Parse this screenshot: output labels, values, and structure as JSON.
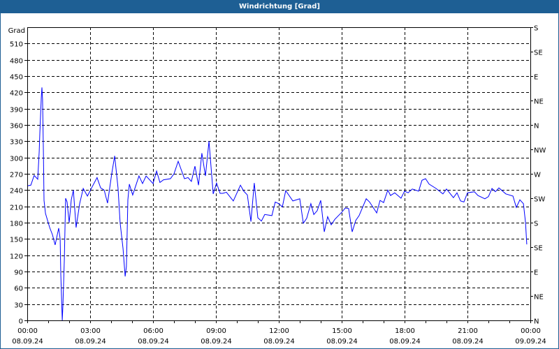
{
  "window": {
    "title": "Windrichtung [Grad]"
  },
  "chart_data": {
    "type": "line",
    "title": "Windrichtung [Grad]",
    "ylabel": "Grad",
    "xlabel": "",
    "ylim": [
      0,
      540
    ],
    "xlim_hours": [
      0,
      24
    ],
    "grid": true,
    "y_ticks": [
      0,
      30,
      60,
      90,
      120,
      150,
      180,
      210,
      240,
      270,
      300,
      330,
      360,
      390,
      420,
      450,
      480,
      510
    ],
    "y_tick_labels": [
      "0",
      "30",
      "60",
      "90",
      "120",
      "150",
      "180",
      "210",
      "240",
      "270",
      "300",
      "330",
      "360",
      "390",
      "420",
      "450",
      "480",
      "510"
    ],
    "right_axis_ticks": [
      0,
      45,
      90,
      135,
      180,
      225,
      270,
      315,
      360,
      405,
      450,
      495,
      540
    ],
    "right_axis_labels": [
      "N",
      "NE",
      "E",
      "SE",
      "S",
      "SW",
      "W",
      "NW",
      "N",
      "NE",
      "E",
      "SE",
      "S"
    ],
    "x_ticks_hours": [
      0,
      3,
      6,
      9,
      12,
      15,
      18,
      21,
      24
    ],
    "x_tick_times": [
      "00:00",
      "03:00",
      "06:00",
      "09:00",
      "12:00",
      "15:00",
      "18:00",
      "21:00",
      "00:00"
    ],
    "x_tick_dates": [
      "08.09.24",
      "08.09.24",
      "08.09.24",
      "08.09.24",
      "08.09.24",
      "08.09.24",
      "08.09.24",
      "08.09.24",
      "09.09.24"
    ],
    "line_color": "#0000ff",
    "series": [
      {
        "name": "Windrichtung",
        "points": [
          [
            0.03,
            248
          ],
          [
            0.17,
            249
          ],
          [
            0.33,
            267
          ],
          [
            0.5,
            260
          ],
          [
            0.57,
            311
          ],
          [
            0.6,
            344
          ],
          [
            0.67,
            411
          ],
          [
            0.7,
            429
          ],
          [
            0.73,
            407
          ],
          [
            0.77,
            312
          ],
          [
            0.8,
            221
          ],
          [
            0.87,
            197
          ],
          [
            1.07,
            171
          ],
          [
            1.2,
            158
          ],
          [
            1.33,
            139
          ],
          [
            1.5,
            170
          ],
          [
            1.57,
            150
          ],
          [
            1.6,
            86
          ],
          [
            1.67,
            0
          ],
          [
            1.7,
            26
          ],
          [
            1.77,
            113
          ],
          [
            1.83,
            225
          ],
          [
            1.9,
            218
          ],
          [
            2.0,
            180
          ],
          [
            2.1,
            222
          ],
          [
            2.2,
            240
          ],
          [
            2.33,
            171
          ],
          [
            2.5,
            215
          ],
          [
            2.67,
            243
          ],
          [
            2.87,
            229
          ],
          [
            3.07,
            244
          ],
          [
            3.33,
            263
          ],
          [
            3.5,
            244
          ],
          [
            3.67,
            240
          ],
          [
            3.83,
            216
          ],
          [
            4.03,
            270
          ],
          [
            4.17,
            303
          ],
          [
            4.33,
            244
          ],
          [
            4.43,
            180
          ],
          [
            4.57,
            132
          ],
          [
            4.67,
            81
          ],
          [
            4.73,
            99
          ],
          [
            4.8,
            222
          ],
          [
            4.87,
            251
          ],
          [
            5.03,
            231
          ],
          [
            5.33,
            266
          ],
          [
            5.5,
            252
          ],
          [
            5.67,
            266
          ],
          [
            6.0,
            252
          ],
          [
            6.17,
            275
          ],
          [
            6.33,
            254
          ],
          [
            6.5,
            259
          ],
          [
            6.83,
            261
          ],
          [
            7.0,
            270
          ],
          [
            7.2,
            293
          ],
          [
            7.5,
            261
          ],
          [
            7.67,
            263
          ],
          [
            7.83,
            256
          ],
          [
            8.0,
            284
          ],
          [
            8.17,
            249
          ],
          [
            8.33,
            308
          ],
          [
            8.5,
            266
          ],
          [
            8.67,
            330
          ],
          [
            8.87,
            233
          ],
          [
            9.03,
            253
          ],
          [
            9.2,
            234
          ],
          [
            9.33,
            234
          ],
          [
            9.5,
            236
          ],
          [
            9.83,
            220
          ],
          [
            10.17,
            249
          ],
          [
            10.33,
            238
          ],
          [
            10.5,
            231
          ],
          [
            10.67,
            182
          ],
          [
            10.83,
            253
          ],
          [
            11.0,
            189
          ],
          [
            11.17,
            183
          ],
          [
            11.33,
            195
          ],
          [
            11.67,
            193
          ],
          [
            11.83,
            218
          ],
          [
            12.0,
            215
          ],
          [
            12.17,
            209
          ],
          [
            12.33,
            239
          ],
          [
            12.67,
            220
          ],
          [
            13.0,
            224
          ],
          [
            13.17,
            179
          ],
          [
            13.33,
            188
          ],
          [
            13.53,
            215
          ],
          [
            13.67,
            195
          ],
          [
            13.83,
            202
          ],
          [
            14.0,
            221
          ],
          [
            14.17,
            163
          ],
          [
            14.33,
            191
          ],
          [
            14.5,
            176
          ],
          [
            14.67,
            186
          ],
          [
            15.0,
            199
          ],
          [
            15.17,
            207
          ],
          [
            15.33,
            206
          ],
          [
            15.5,
            163
          ],
          [
            15.67,
            184
          ],
          [
            15.83,
            193
          ],
          [
            16.17,
            224
          ],
          [
            16.33,
            218
          ],
          [
            16.67,
            198
          ],
          [
            16.83,
            221
          ],
          [
            17.0,
            217
          ],
          [
            17.2,
            240
          ],
          [
            17.33,
            230
          ],
          [
            17.53,
            235
          ],
          [
            17.83,
            225
          ],
          [
            18.0,
            238
          ],
          [
            18.17,
            235
          ],
          [
            18.37,
            242
          ],
          [
            18.67,
            238
          ],
          [
            18.83,
            258
          ],
          [
            19.0,
            261
          ],
          [
            19.17,
            251
          ],
          [
            19.5,
            243
          ],
          [
            19.83,
            233
          ],
          [
            20.0,
            242
          ],
          [
            20.33,
            226
          ],
          [
            20.5,
            235
          ],
          [
            20.67,
            220
          ],
          [
            20.83,
            218
          ],
          [
            21.0,
            235
          ],
          [
            21.33,
            237
          ],
          [
            21.5,
            230
          ],
          [
            21.83,
            224
          ],
          [
            22.0,
            228
          ],
          [
            22.17,
            243
          ],
          [
            22.33,
            237
          ],
          [
            22.5,
            244
          ],
          [
            22.83,
            233
          ],
          [
            23.17,
            229
          ],
          [
            23.33,
            208
          ],
          [
            23.5,
            222
          ],
          [
            23.67,
            215
          ],
          [
            23.77,
            180
          ],
          [
            23.83,
            140
          ]
        ]
      }
    ]
  }
}
